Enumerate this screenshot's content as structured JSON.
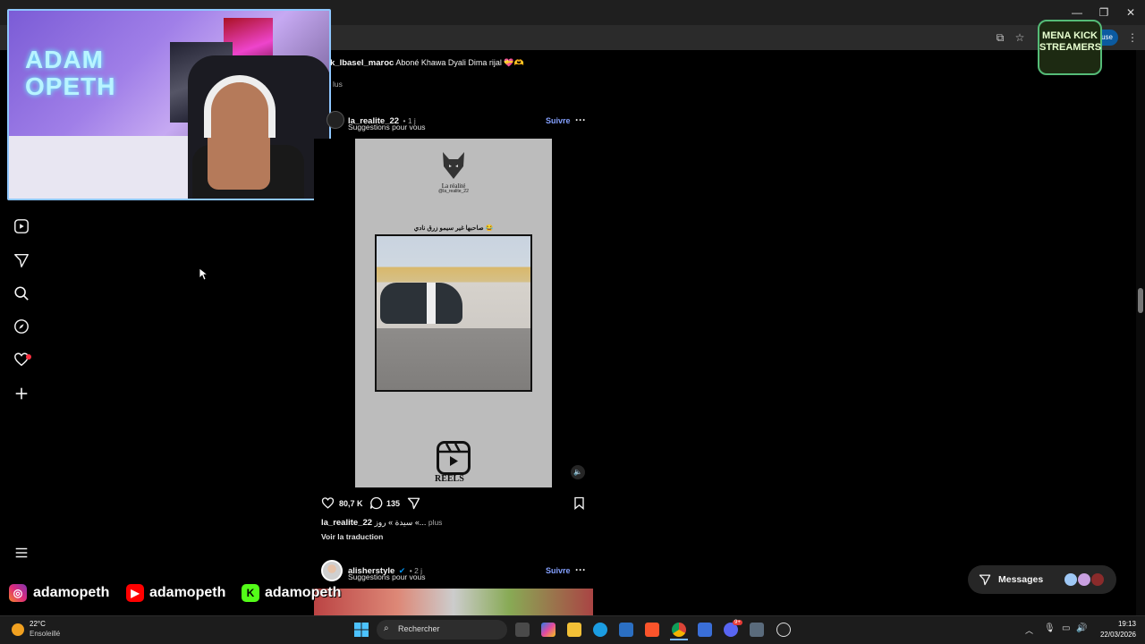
{
  "browser": {
    "pause_label": "pause",
    "window_controls": [
      "minimize-icon",
      "restore-icon",
      "close-icon"
    ]
  },
  "sidebar": {
    "icons": [
      "reels-icon",
      "send-icon",
      "search-icon",
      "explore-icon",
      "heart-icon",
      "plus-icon",
      "menu-icon"
    ]
  },
  "webcam": {
    "sign_text": "ADAM\nOPETH"
  },
  "feed": {
    "comment": {
      "handle": "k_lbasel_maroc",
      "text": "Aboné Khawa Dyali Dima rijal 💝🫶"
    },
    "more_label": "lus",
    "post1": {
      "handle": "la_realite_22",
      "age": "• 1 j",
      "subtitle": "Suggestions pour vous",
      "follow": "Suivre",
      "media_watermark": "La réalité",
      "media_watermark_sub": "@la_realite_22",
      "media_caption_ar": "صاحبها غير سيمو زرق نادي 😂",
      "reels_label": "REELS",
      "likes": "80,7 K",
      "comments": "135",
      "caption_handle": "la_realite_22",
      "caption_text": "سيدة » روز «...",
      "caption_more": "plus",
      "translate": "Voir la traduction"
    },
    "post2": {
      "handle": "alisherstyle",
      "age": "• 2 j",
      "subtitle": "Suggestions pour vous",
      "follow": "Suivre"
    }
  },
  "overlay": {
    "kick_logo_text": "MENA KICK STREAMERS",
    "social_handles": [
      "adamopeth",
      "adamopeth",
      "adamopeth"
    ]
  },
  "messages": {
    "label": "Messages"
  },
  "taskbar": {
    "weather_temp": "22°C",
    "weather_desc": "Ensoleillé",
    "search_placeholder": "Rechercher",
    "time": "19:13",
    "date": "22/03/2026",
    "discord_badge": "9+"
  },
  "colors": {
    "accent": "#85a1ff",
    "notif": "#ff3040",
    "kick": "#53fc18"
  }
}
